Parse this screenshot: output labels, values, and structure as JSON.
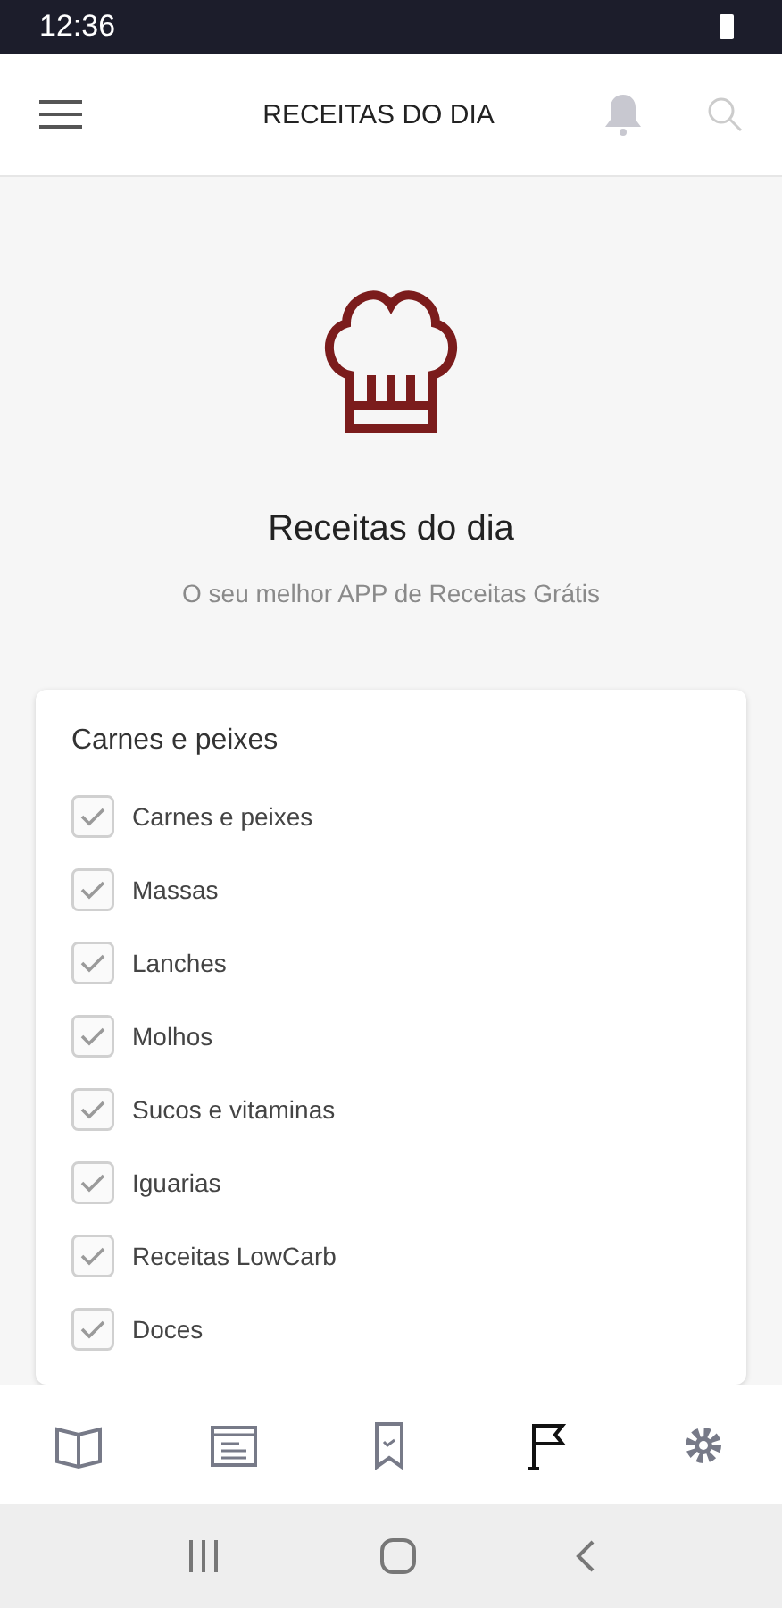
{
  "status_bar": {
    "time": "12:36"
  },
  "app_bar": {
    "title": "RECEITAS DO DIA"
  },
  "hero": {
    "title": "Receitas do dia",
    "subtitle": "O seu melhor APP de Receitas Grátis"
  },
  "card": {
    "title": "Carnes e peixes",
    "items": [
      {
        "label": "Carnes e peixes",
        "checked": true
      },
      {
        "label": "Massas",
        "checked": true
      },
      {
        "label": "Lanches",
        "checked": true
      },
      {
        "label": "Molhos",
        "checked": true
      },
      {
        "label": "Sucos e vitaminas",
        "checked": true
      },
      {
        "label": "Iguarias",
        "checked": true
      },
      {
        "label": "Receitas LowCarb",
        "checked": true
      },
      {
        "label": "Doces",
        "checked": true
      }
    ]
  },
  "bottom_nav": [
    {
      "kind": "book",
      "selected": false
    },
    {
      "kind": "notepad",
      "selected": false
    },
    {
      "kind": "bookmark",
      "selected": false
    },
    {
      "kind": "flag",
      "selected": true
    },
    {
      "kind": "settings",
      "selected": false
    }
  ]
}
